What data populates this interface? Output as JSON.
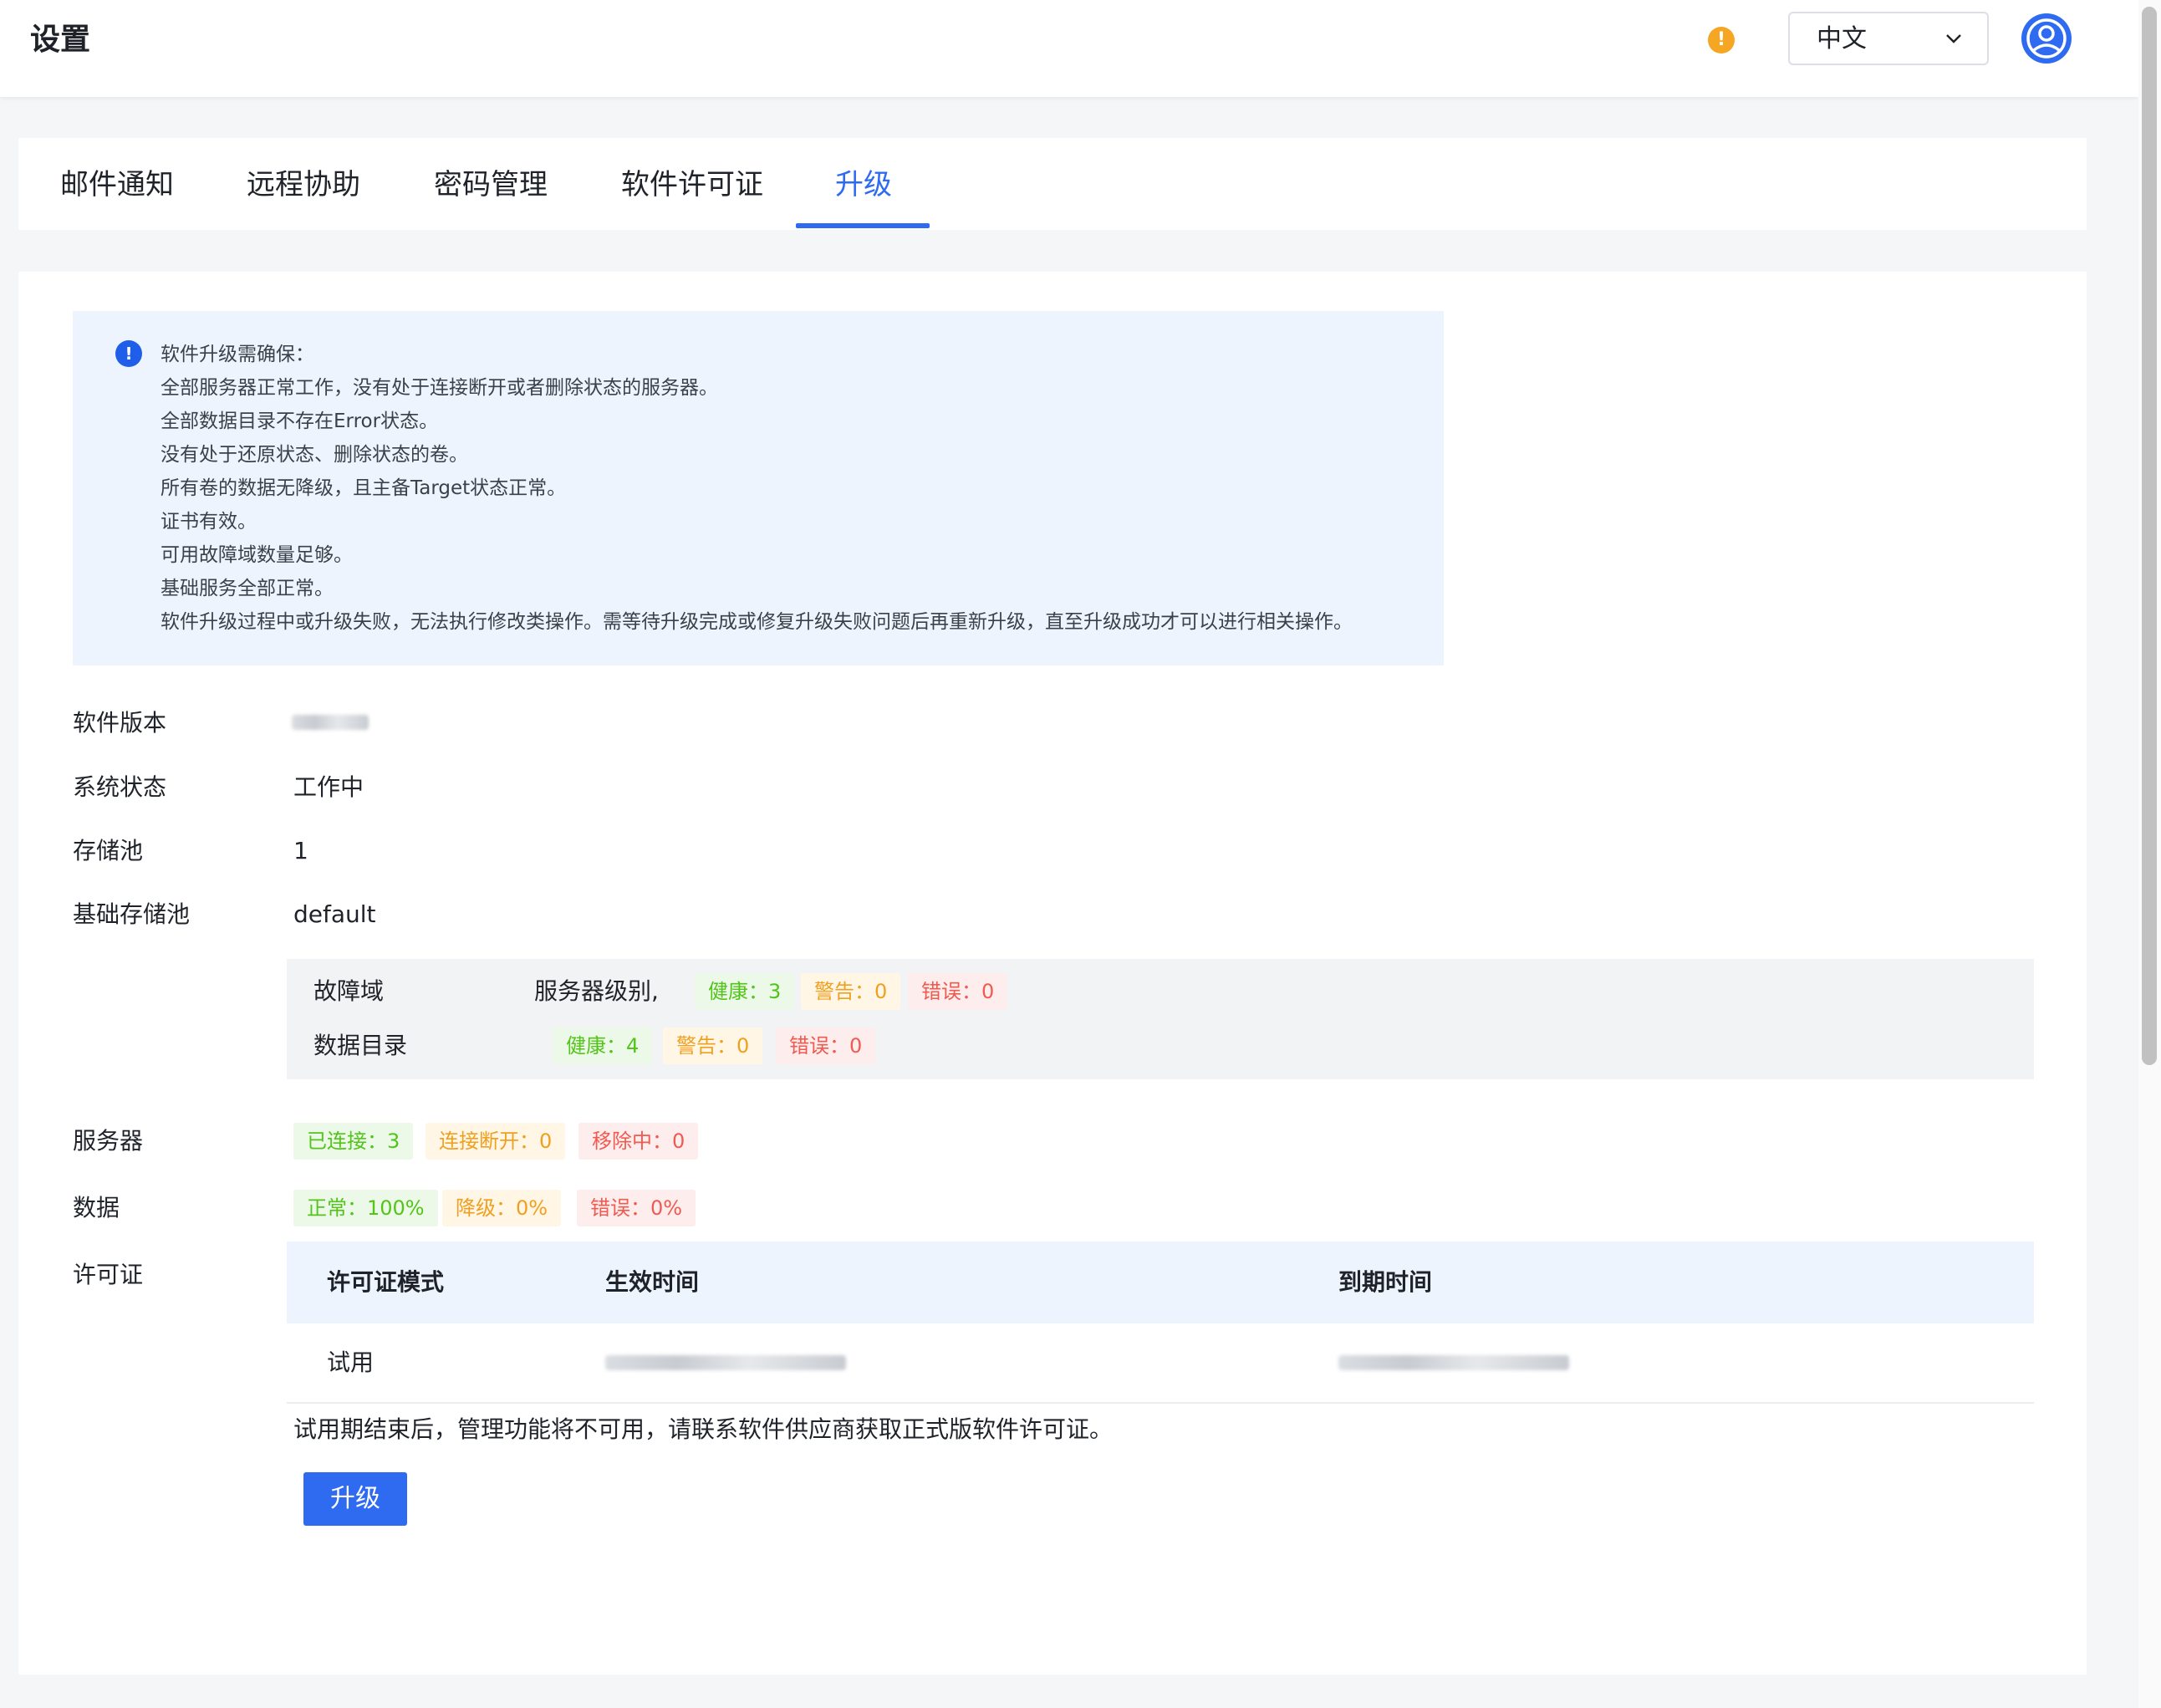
{
  "header": {
    "title": "设置",
    "language": "中文"
  },
  "tabs": [
    {
      "label": "邮件通知"
    },
    {
      "label": "远程协助"
    },
    {
      "label": "密码管理"
    },
    {
      "label": "软件许可证"
    },
    {
      "label": "升级",
      "active": true
    }
  ],
  "notice": {
    "lines": [
      "软件升级需确保：",
      "全部服务器正常工作，没有处于连接断开或者删除状态的服务器。",
      "全部数据目录不存在Error状态。",
      "没有处于还原状态、删除状态的卷。",
      "所有卷的数据无降级，且主备Target状态正常。",
      "证书有效。",
      "可用故障域数量足够。",
      "基础服务全部正常。",
      "软件升级过程中或升级失败，无法执行修改类操作。需等待升级完成或修复升级失败问题后再重新升级，直至升级成功才可以进行相关操作。"
    ]
  },
  "info": {
    "software_version_label": "软件版本",
    "system_status_label": "系统状态",
    "system_status_value": "工作中",
    "storage_pool_label": "存储池",
    "storage_pool_value": "1",
    "base_pool_label": "基础存储池",
    "base_pool_value": "default"
  },
  "pool_detail": {
    "fault_domain_label": "故障域",
    "fault_domain_level": "服务器级别,",
    "fault_domain_healthy": "健康：3",
    "fault_domain_warning": "警告：0",
    "fault_domain_error": "错误：0",
    "data_dir_label": "数据目录",
    "data_dir_healthy": "健康：4",
    "data_dir_warning": "警告：0",
    "data_dir_error": "错误：0"
  },
  "servers": {
    "label": "服务器",
    "connected": "已连接：3",
    "disconnected": "连接断开：0",
    "removing": "移除中：0"
  },
  "data": {
    "label": "数据",
    "normal": "正常：100%",
    "degraded": "降级：0%",
    "error": "错误：0%"
  },
  "license": {
    "label": "许可证",
    "columns": [
      "许可证模式",
      "生效时间",
      "到期时间"
    ],
    "row": {
      "mode": "试用"
    },
    "trial_note": "试用期结束后，管理功能将不可用，请联系软件供应商获取正式版软件许可证。"
  },
  "upgrade_button": "升级",
  "colors": {
    "accent": "#2f6bf1",
    "healthy": "#52c41a",
    "warning": "#f0a020",
    "error": "#f05a50",
    "alert_icon": "#f5a623"
  },
  "icons": {
    "alert": "exclamation-circle-icon",
    "info": "info-circle-icon",
    "language_dropdown": "chevron-down-icon",
    "user": "user-avatar-icon"
  }
}
